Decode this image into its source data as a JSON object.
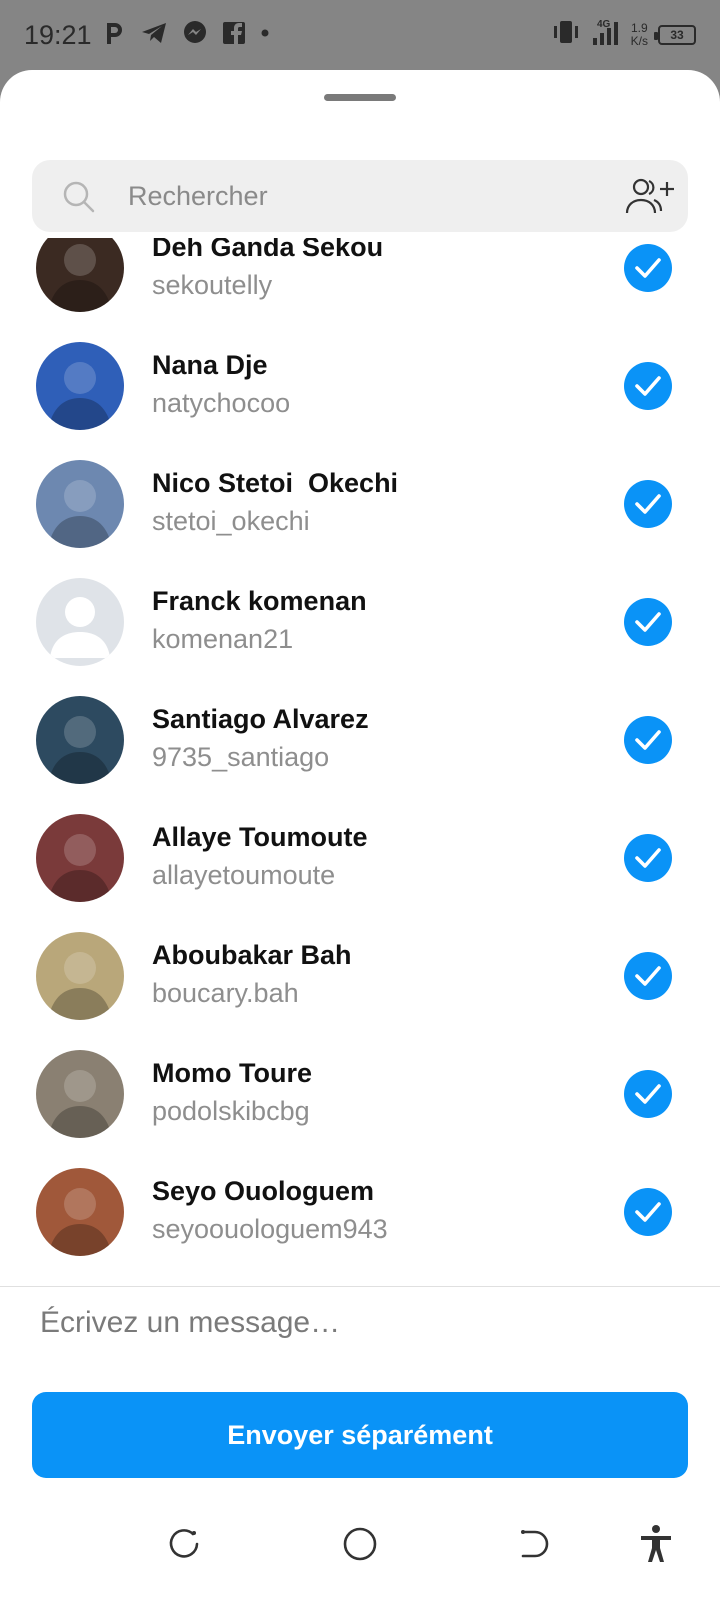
{
  "status_bar": {
    "time": "19:21",
    "left_icons": [
      "parking-icon",
      "telegram-icon",
      "messenger-icon",
      "facebook-icon",
      "dot-icon"
    ],
    "network": "4G",
    "speed_value": "1.9",
    "speed_unit": "K/s",
    "battery": "33"
  },
  "search": {
    "placeholder": "Rechercher"
  },
  "contacts": [
    {
      "name": "Deh Ganda Sekou",
      "username": "sekoutelly",
      "selected": true,
      "avatar_color": "#3b2a22"
    },
    {
      "name": "Nana Dje",
      "username": "natychocoo",
      "selected": true,
      "avatar_color": "#2f5fb8"
    },
    {
      "name": "Nico Stetoi  Okechi",
      "username": "stetoi_okechi",
      "selected": true,
      "avatar_color": "#6d88b0"
    },
    {
      "name": "Franck komenan",
      "username": "komenan21",
      "selected": true,
      "avatar_color": "#dfe3e8"
    },
    {
      "name": "Santiago Alvarez",
      "username": "9735_santiago",
      "selected": true,
      "avatar_color": "#2d4a60"
    },
    {
      "name": "Allaye Toumoute",
      "username": "allayetoumoute",
      "selected": true,
      "avatar_color": "#7a3a3a"
    },
    {
      "name": "Aboubakar Bah",
      "username": "boucary.bah",
      "selected": true,
      "avatar_color": "#b9a77a"
    },
    {
      "name": "Momo Toure",
      "username": "podolskibcbg",
      "selected": true,
      "avatar_color": "#8a8072"
    },
    {
      "name": "Seyo Ouologuem",
      "username": "seyoouologuem943",
      "selected": true,
      "avatar_color": "#a0583a"
    }
  ],
  "composer": {
    "placeholder": "Écrivez un message…"
  },
  "send_button": {
    "label": "Envoyer séparément"
  },
  "colors": {
    "accent": "#0a93f7",
    "sheet": "#ffffff",
    "status_bar": "#858585"
  }
}
